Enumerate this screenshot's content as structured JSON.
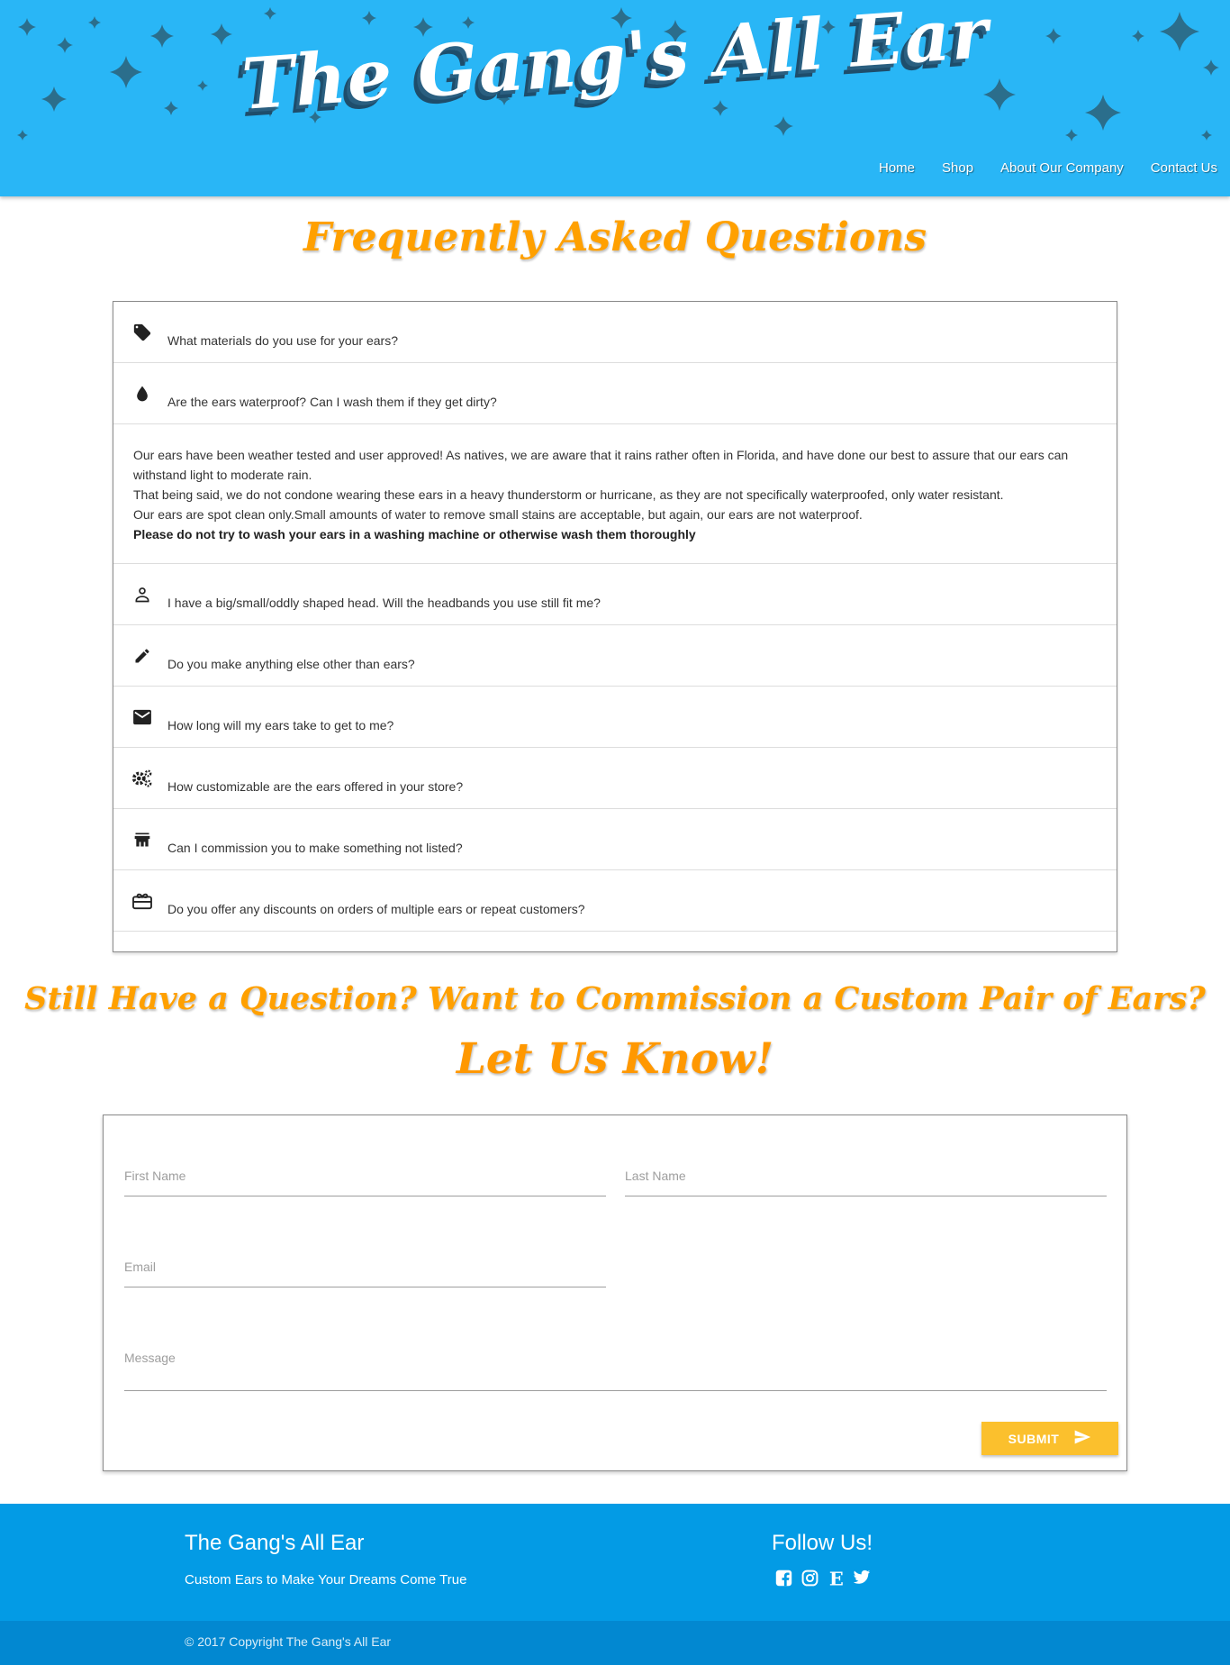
{
  "colors": {
    "header_bg": "#29b6f6",
    "accent": "#ffa000",
    "submit": "#fbc02d",
    "footer": "#039be5"
  },
  "header": {
    "logo": "The Gang's All Ear",
    "nav": [
      "Home",
      "Shop",
      "About Our Company",
      "Contact Us"
    ]
  },
  "faq": {
    "title": "Frequently Asked Questions",
    "items": [
      {
        "icon": "tag-icon",
        "question": "What materials do you use for your ears?"
      },
      {
        "icon": "water-drop-icon",
        "question": "Are the ears waterproof? Can I wash them if they get dirty?"
      },
      {
        "icon": "person-icon",
        "question": "I have a big/small/oddly shaped head. Will the headbands you use still fit me?"
      },
      {
        "icon": "pencil-icon",
        "question": "Do you make anything else other than ears?"
      },
      {
        "icon": "mail-icon",
        "question": "How long will my ears take to get to me?"
      },
      {
        "icon": "gears-icon",
        "question": "How customizable are the ears offered in your store?"
      },
      {
        "icon": "store-icon",
        "question": "Can I commission you to make something not listed?"
      },
      {
        "icon": "gift-card-icon",
        "question": "Do you offer any discounts on orders of multiple ears or repeat customers?"
      }
    ],
    "answer": {
      "p1": "Our ears have been weather tested and user approved! As natives, we are aware that it rains rather often in Florida, and have done our best to assure that our ears can withstand light to moderate rain.",
      "p2": "That being said, we do not condone wearing these ears in a heavy thunderstorm or hurricane, as they are not specifically waterproofed, only water resistant.",
      "p3": "Our ears are spot clean only.Small amounts of water to remove small stains are acceptable, but again, our ears are not waterproof.",
      "bold": "Please do not try to wash your ears in a washing machine or otherwise wash them thoroughly"
    }
  },
  "contact": {
    "title": "Still Have a Question? Want to Commission a Custom Pair of Ears?",
    "subtitle": "Let Us Know!",
    "first_name": "First Name",
    "last_name": "Last Name",
    "email": "Email",
    "message": "Message",
    "submit": "Submit"
  },
  "footer": {
    "title": "The Gang's All Ear",
    "tagline": "Custom Ears to Make Your Dreams Come True",
    "follow": "Follow Us!",
    "social": [
      "facebook-icon",
      "instagram-icon",
      "etsy-icon",
      "twitter-icon"
    ],
    "copyright": "© 2017 Copyright The Gang's All Ear"
  }
}
